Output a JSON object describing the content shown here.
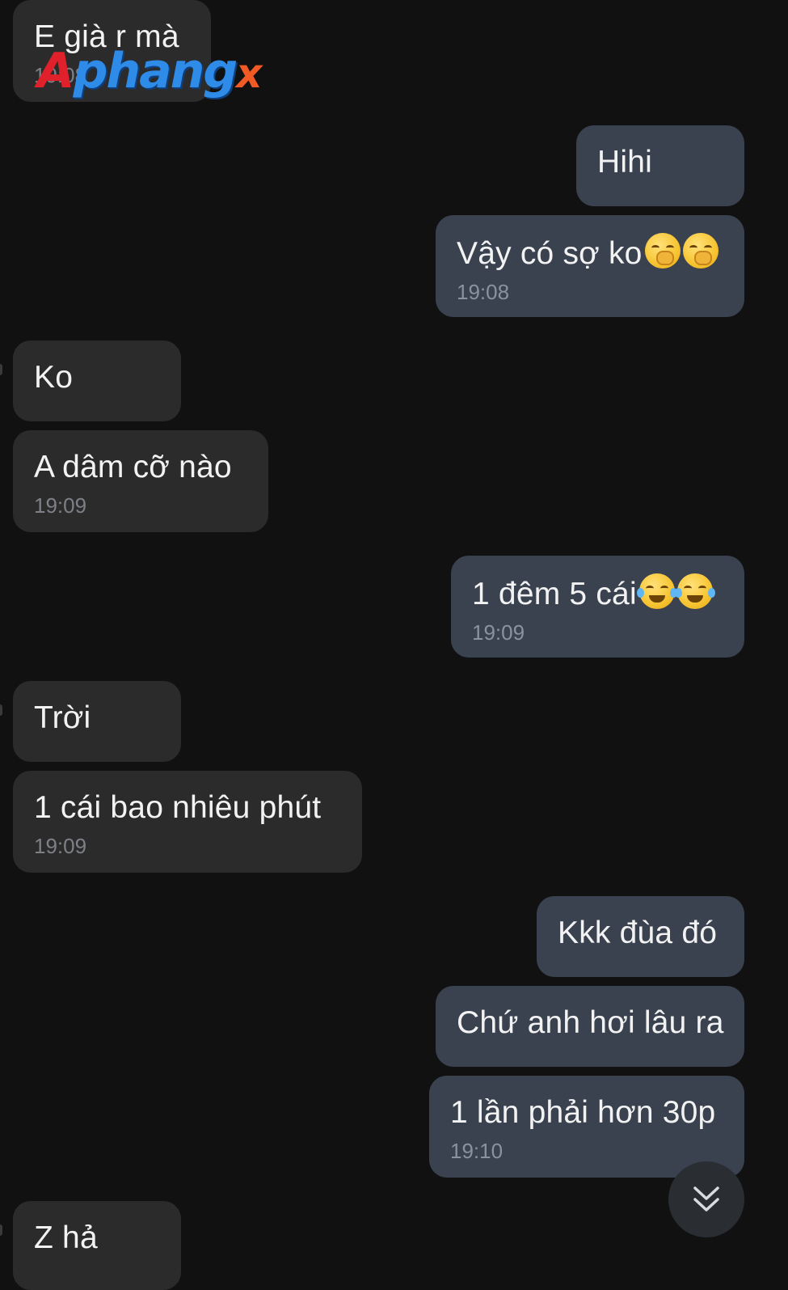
{
  "watermark": {
    "part1": "A",
    "part2": "phang",
    "part3": "x"
  },
  "messages": [
    {
      "id": "m1",
      "side": "incoming",
      "text": "E già r mà",
      "time": "19:08"
    },
    {
      "id": "m2",
      "side": "outgoing",
      "text": "Hihi",
      "time": ""
    },
    {
      "id": "m3",
      "side": "outgoing",
      "text": "Vậy có sợ ko",
      "emoji": "face-with-hand-over-mouth",
      "time": "19:08"
    },
    {
      "id": "m4",
      "side": "incoming",
      "text": "Ko",
      "time": ""
    },
    {
      "id": "m5",
      "side": "incoming",
      "text": "A dâm cỡ nào",
      "time": "19:09"
    },
    {
      "id": "m6",
      "side": "outgoing",
      "text": "1 đêm 5 cái",
      "emoji": "rolling-on-the-floor-laughing",
      "time": "19:09"
    },
    {
      "id": "m7",
      "side": "incoming",
      "text": "Trời",
      "time": ""
    },
    {
      "id": "m8",
      "side": "incoming",
      "text": "1 cái bao nhiêu phút",
      "time": "19:09"
    },
    {
      "id": "m9",
      "side": "outgoing",
      "text": "Kkk đùa đó",
      "time": ""
    },
    {
      "id": "m10",
      "side": "outgoing",
      "text": "Chứ anh hơi lâu ra",
      "time": ""
    },
    {
      "id": "m11",
      "side": "outgoing",
      "text": "1 lần phải hơn 30p",
      "time": "19:10"
    },
    {
      "id": "m12",
      "side": "incoming",
      "text": "Z hả",
      "time": ""
    }
  ],
  "scroll_button": {
    "icon": "double-chevron-down-icon"
  },
  "colors": {
    "background": "#111111",
    "incoming_bubble": "#2b2b2b",
    "outgoing_bubble": "#3a4250",
    "text": "#f2f2f2",
    "time": "#7d8086"
  }
}
